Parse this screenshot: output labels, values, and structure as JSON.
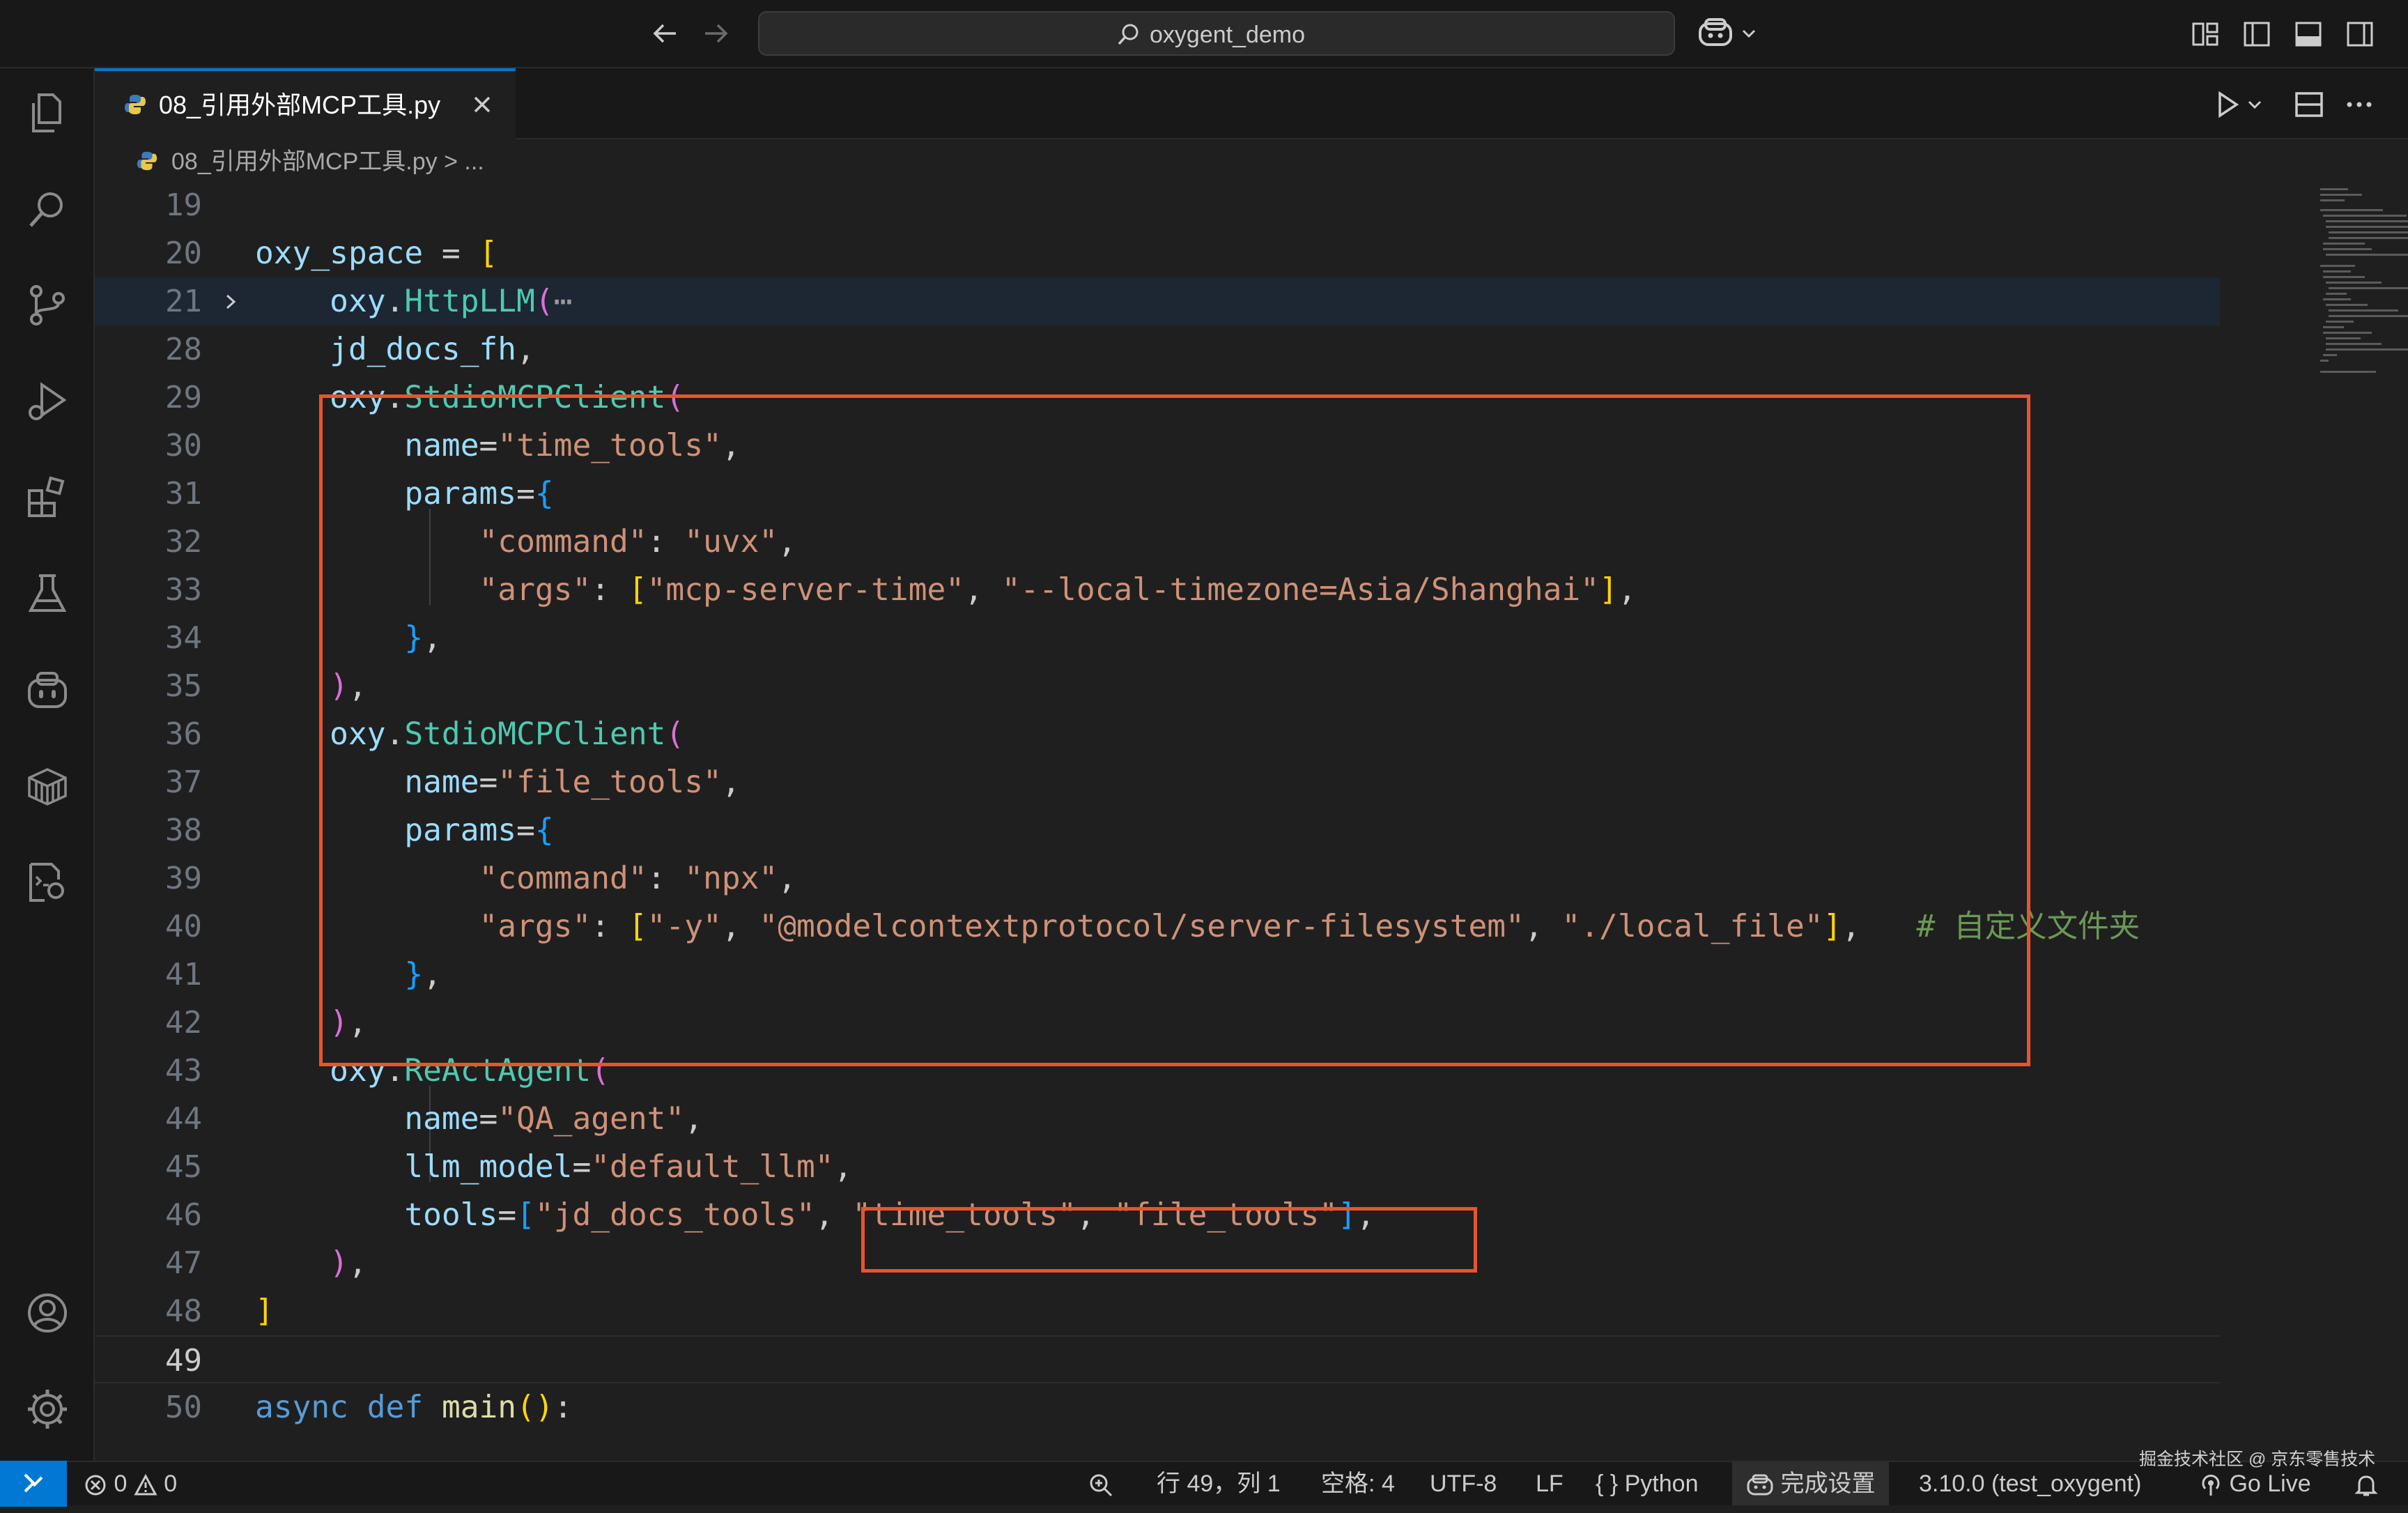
{
  "titlebar": {
    "search_label": "oxygent_demo"
  },
  "tab": {
    "label": "08_引用外部MCP工具.py"
  },
  "breadcrumb": {
    "file": "08_引用外部MCP工具.py",
    "separator": ">",
    "more": "..."
  },
  "editor": {
    "line_numbers": [
      "19",
      "20",
      "21",
      "28",
      "29",
      "30",
      "31",
      "32",
      "33",
      "34",
      "35",
      "36",
      "37",
      "38",
      "39",
      "40",
      "41",
      "42",
      "43",
      "44",
      "45",
      "46",
      "47",
      "48",
      "49",
      "50"
    ],
    "tokens": {
      "l20": [
        "oxy_space",
        " = ",
        "["
      ],
      "l21": [
        "oxy",
        ".",
        "HttpLLM",
        "(",
        "⋯"
      ],
      "l28": [
        "jd_docs_fh",
        ","
      ],
      "l29": [
        "oxy",
        ".",
        "StdioMCPClient",
        "("
      ],
      "l30": [
        "name",
        "=",
        "\"time_tools\"",
        ","
      ],
      "l31": [
        "params",
        "=",
        "{"
      ],
      "l32": [
        "\"command\"",
        ": ",
        "\"uvx\"",
        ","
      ],
      "l33": [
        "\"args\"",
        ": ",
        "[",
        "\"mcp-server-time\"",
        ", ",
        "\"--local-timezone=Asia/Shanghai\"",
        "]",
        ","
      ],
      "l34": [
        "}",
        ","
      ],
      "l35": [
        ")",
        ","
      ],
      "l36": [
        "oxy",
        ".",
        "StdioMCPClient",
        "("
      ],
      "l37": [
        "name",
        "=",
        "\"file_tools\"",
        ","
      ],
      "l38": [
        "params",
        "=",
        "{"
      ],
      "l39": [
        "\"command\"",
        ": ",
        "\"npx\"",
        ","
      ],
      "l40": [
        "\"args\"",
        ": ",
        "[",
        "\"-y\"",
        ", ",
        "\"@modelcontextprotocol/server-filesystem\"",
        ", ",
        "\"./local_file\"",
        "]",
        ",",
        "   # 自定义文件夹"
      ],
      "l41": [
        "}",
        ","
      ],
      "l42": [
        ")",
        ","
      ],
      "l43": [
        "oxy",
        ".",
        "ReActAgent",
        "("
      ],
      "l44": [
        "name",
        "=",
        "\"QA_agent\"",
        ","
      ],
      "l45": [
        "llm_model",
        "=",
        "\"default_llm\"",
        ","
      ],
      "l46": [
        "tools",
        "=",
        "[",
        "\"jd_docs_tools\"",
        ", ",
        "\"time_tools\"",
        ", ",
        "\"file_tools\"",
        "]",
        ","
      ],
      "l47": [
        ")",
        ","
      ],
      "l48": [
        "]"
      ],
      "l50": [
        "async",
        " ",
        "def",
        " ",
        "main",
        "()",
        ":"
      ]
    }
  },
  "statusbar": {
    "errors": "0",
    "warnings": "0",
    "position": "行 49，列 1",
    "spaces": "空格: 4",
    "encoding": "UTF-8",
    "eol": "LF",
    "language_glyph": "{ }",
    "language": "Python",
    "setup": "完成设置",
    "interpreter": "3.10.0 (test_oxygent)",
    "golive": "Go Live"
  },
  "watermark": "掘金技术社区 @ 京东零售技术",
  "icons": {
    "activity": [
      "explorer-icon",
      "search-icon",
      "source-control-icon",
      "run-debug-icon",
      "extensions-icon",
      "testing-icon",
      "copilot-chat-icon",
      "containers-icon",
      "remote-tools-icon",
      "account-icon",
      "settings-gear-icon"
    ]
  },
  "colors": {
    "highlight_box": "#e8542c",
    "accent": "#0078d4",
    "string": "#ce9178",
    "class": "#4ec9b0",
    "variable": "#9cdcfe",
    "keyword": "#569cd6",
    "comment": "#6a9955"
  }
}
